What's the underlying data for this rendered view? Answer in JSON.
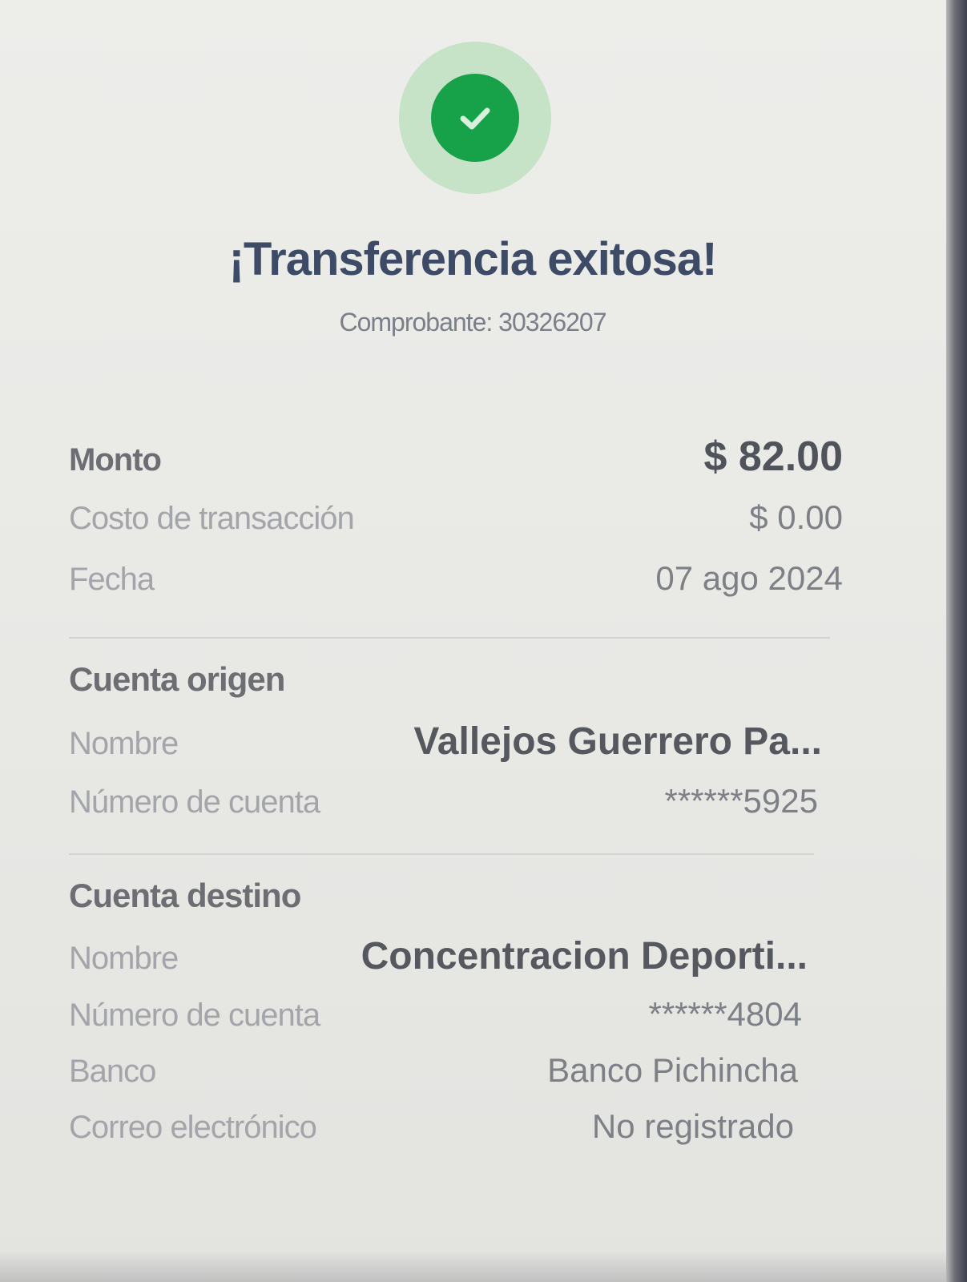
{
  "status": {
    "icon": "check-icon",
    "title": "¡Transferencia exitosa!",
    "receipt": "Comprobante: 30326207",
    "colors": {
      "success": "#17a24a",
      "success_halo": "#c6e3c8",
      "title": "#3d4b66"
    }
  },
  "summary": {
    "amount_label": "Monto",
    "amount_value": "$ 82.00",
    "fee_label": "Costo de transacción",
    "fee_value": "$ 0.00",
    "date_label": "Fecha",
    "date_value": "07 ago 2024"
  },
  "origin": {
    "section_title": "Cuenta origen",
    "name_label": "Nombre",
    "name_value": "Vallejos Guerrero Pa...",
    "account_label": "Número de cuenta",
    "account_value": "******5925"
  },
  "destination": {
    "section_title": "Cuenta destino",
    "name_label": "Nombre",
    "name_value": "Concentracion Deporti...",
    "account_label": "Número de cuenta",
    "account_value": "******4804",
    "bank_label": "Banco",
    "bank_value": "Banco Pichincha",
    "email_label": "Correo electrónico",
    "email_value": "No registrado"
  }
}
